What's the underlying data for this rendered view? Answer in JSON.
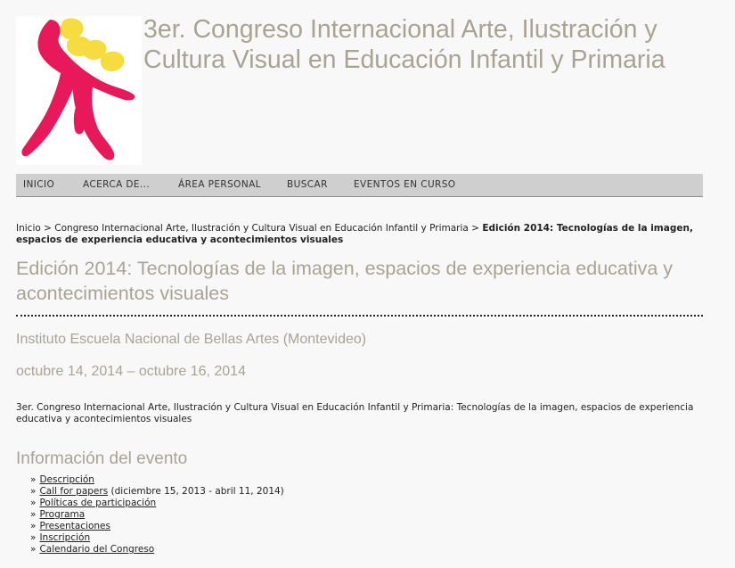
{
  "colors": {
    "title_gray": "#a8a392",
    "logo_pink": "#e8195a",
    "logo_yellow": "#f6dc3e",
    "nav_bg": "#cfcfcf"
  },
  "header": {
    "title_line1": "3er. Congreso Internacional Arte, Ilustración y",
    "title_line2": "Cultura Visual en Educación Infantil y Primaria"
  },
  "nav": {
    "items": [
      "INICIO",
      "ACERCA DE...",
      "ÁREA PERSONAL",
      "BUSCAR",
      "EVENTOS EN CURSO"
    ]
  },
  "breadcrumb": {
    "home": "Inicio",
    "separator": " > ",
    "conference": "Congreso Internacional Arte, Ilustración y Cultura Visual en Educación Infantil y Primaria",
    "current": "Edición 2014: Tecnologías de la imagen, espacios de experiencia educativa y acontecimientos visuales"
  },
  "main": {
    "title": "Edición 2014: Tecnologías de la imagen, espacios de experiencia educativa y acontecimientos visuales",
    "venue": "Instituto Escuela Nacional de Bellas Artes (Montevideo)",
    "dates": "octubre 14, 2014 – octubre 16, 2014",
    "intro": "3er. Congreso Internacional Arte, Ilustración y Cultura Visual en Educación Infantil y Primaria: Tecnologías de la imagen, espacios de experiencia educativa y acontecimientos visuales"
  },
  "event_info": {
    "heading": "Información del evento",
    "bullet": "»",
    "links": [
      {
        "label": "Descripción",
        "note": ""
      },
      {
        "label": "Call for papers",
        "note": " (diciembre 15, 2013 - abril 11, 2014)"
      },
      {
        "label": "Políticas de participación",
        "note": ""
      },
      {
        "label": "Programa",
        "note": ""
      },
      {
        "label": "Presentaciones",
        "note": ""
      },
      {
        "label": "Inscripción",
        "note": ""
      },
      {
        "label": "Calendario del Congreso",
        "note": ""
      }
    ]
  }
}
